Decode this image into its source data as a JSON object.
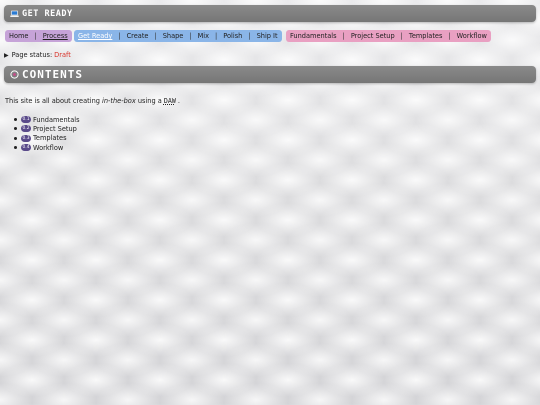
{
  "header": {
    "icon": "laptop-icon",
    "title": "Get Ready"
  },
  "nav_primary": {
    "items": [
      "Home",
      "Process"
    ],
    "current": "Process"
  },
  "nav_process": {
    "items": [
      "Get Ready",
      "Create",
      "Shape",
      "Mix",
      "Polish",
      "Ship It"
    ],
    "current": "Get Ready"
  },
  "nav_stage": {
    "items": [
      "Fundamentals",
      "Project Setup",
      "Templates",
      "Workflow"
    ]
  },
  "status": {
    "label": "Page status:",
    "value": "Draft"
  },
  "contents": {
    "icon": "target-icon",
    "title": "Contents"
  },
  "intro": {
    "before": "This site is all about creating ",
    "emphasis": "in-the-box",
    "middle": " using a ",
    "abbr": "DAW",
    "after": " ."
  },
  "toc": [
    {
      "num": "0.1",
      "label": "Fundamentals"
    },
    {
      "num": "0.2",
      "label": "Project Setup"
    },
    {
      "num": "0.3",
      "label": "Templates"
    },
    {
      "num": "0.4",
      "label": "Workflow"
    }
  ],
  "colors": {
    "primary_nav": "#c6a3d8",
    "process_nav": "#8ab5e8",
    "stage_nav": "#e9a0c2",
    "status_draft": "#d9342b",
    "banner": "#7f7f7f"
  }
}
